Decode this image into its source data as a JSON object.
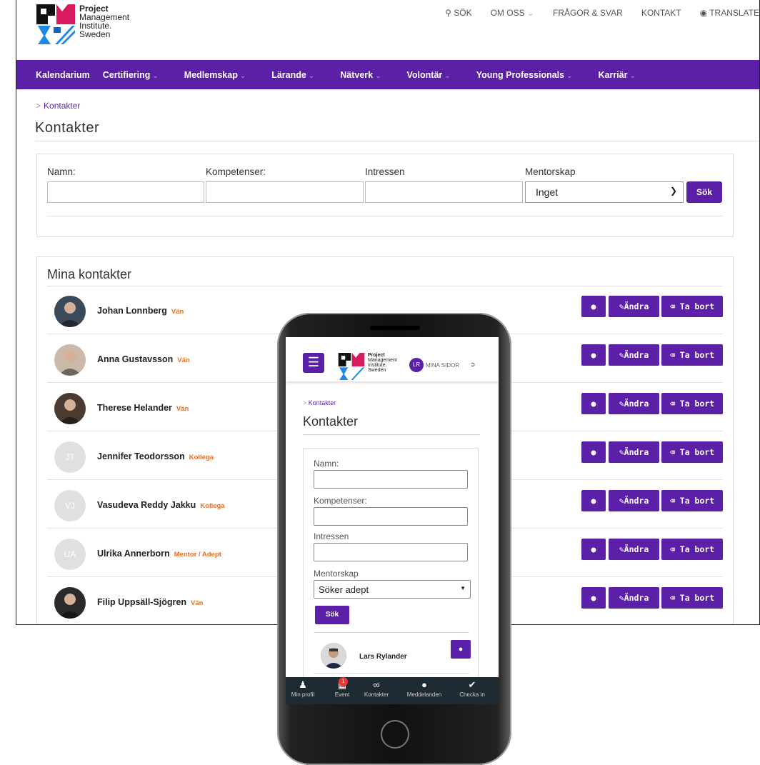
{
  "brand": {
    "line1": "Project",
    "line2": "Management",
    "line3": "Institute.",
    "line4": "Sweden",
    "colors": {
      "primary": "#5c1fa8",
      "tag": "#e8702a",
      "logo_magenta": "#d81b60",
      "logo_cyan": "#1e88e5"
    }
  },
  "topnav": {
    "search": "SÖK",
    "about": "OM OSS",
    "faq": "FRÅGOR & SVAR",
    "contact": "KONTAKT",
    "translate": "TRANSLATE"
  },
  "mainnav": [
    "Kalendarium",
    "Certifiering",
    "Medlemskap",
    "Lärande",
    "Nätverk",
    "Volontär",
    "Young Professionals",
    "Karriär"
  ],
  "breadcrumb": "Kontakter",
  "page_title": "Kontakter",
  "search": {
    "name_label": "Namn:",
    "skills_label": "Kompetenser:",
    "interests_label": "Intressen",
    "mentor_label": "Mentorskap",
    "mentor_value": "Inget",
    "submit": "Sök"
  },
  "contacts": {
    "title": "Mina kontakter",
    "buttons": {
      "edit": "Ändra",
      "delete": "Ta bort"
    },
    "rows": [
      {
        "name": "Johan Lonnberg",
        "tag": "Vän",
        "initials": ""
      },
      {
        "name": "Anna Gustavsson",
        "tag": "Vän",
        "initials": ""
      },
      {
        "name": "Therese Helander",
        "tag": "Vän",
        "initials": ""
      },
      {
        "name": "Jennifer Teodorsson",
        "tag": "Kollega",
        "initials": "JT"
      },
      {
        "name": "Vasudeva Reddy Jakku",
        "tag": "Kollega",
        "initials": "VJ"
      },
      {
        "name": "Ulrika Annerborn",
        "tag": "Mentor / Adept",
        "initials": "UA"
      },
      {
        "name": "Filip Uppsäll-Sjögren",
        "tag": "Vän",
        "initials": ""
      }
    ]
  },
  "mobile": {
    "avatar_initials": "LR",
    "my_pages": "MINA SIDOR",
    "breadcrumb": "Kontakter",
    "title": "Kontakter",
    "name_label": "Namn:",
    "skills_label": "Kompetenser:",
    "interests_label": "Intressen",
    "mentor_label": "Mentorskap",
    "mentor_value": "Söker adept",
    "submit": "Sök",
    "contact_name": "Lars Rylander",
    "tabs": [
      {
        "label": "Min profil",
        "icon": "user-icon"
      },
      {
        "label": "Event",
        "icon": "calendar-icon",
        "badge": "1"
      },
      {
        "label": "Kontakter",
        "icon": "link-icon"
      },
      {
        "label": "Meddelanden",
        "icon": "chat-icon"
      },
      {
        "label": "Checka in",
        "icon": "check-icon"
      }
    ]
  }
}
